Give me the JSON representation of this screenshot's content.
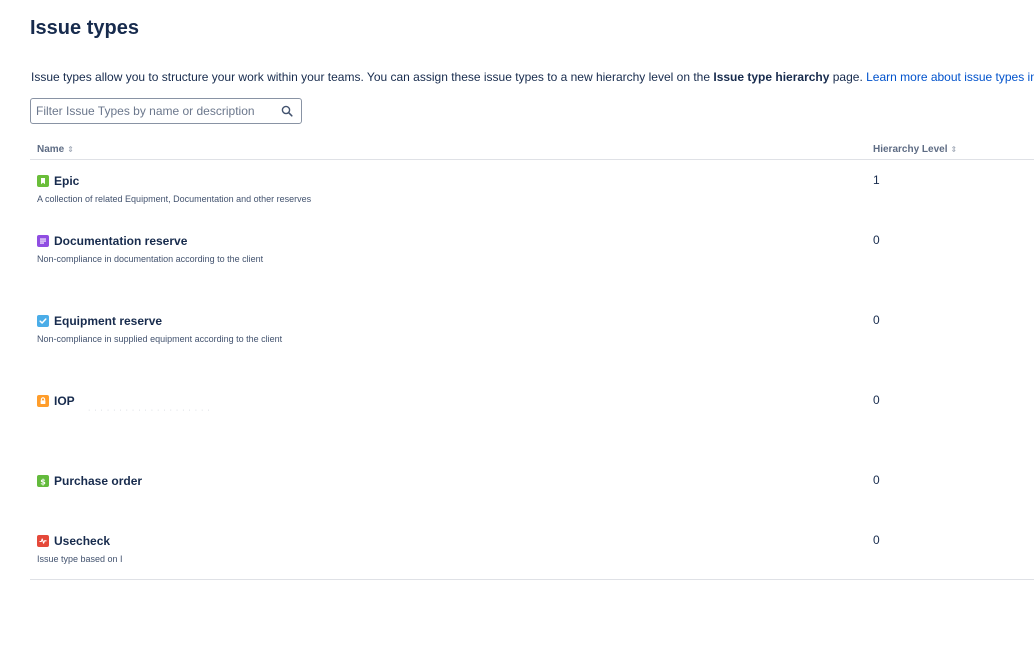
{
  "page": {
    "title": "Issue types",
    "intro": {
      "text_before": "Issue types allow you to structure your work within your teams. You can assign these issue types to a new hierarchy level on the ",
      "bold": "Issue type hierarchy",
      "text_after": " page. ",
      "link": "Learn more about issue types in Jira."
    }
  },
  "search": {
    "placeholder": "Filter Issue Types by name or description",
    "value": "",
    "icon": "search-icon"
  },
  "table": {
    "columns": {
      "name": "Name",
      "hierarchy": "Hierarchy Level"
    },
    "rows": [
      {
        "name": "Epic",
        "description": "A collection of related Equipment, Documentation and other reserves",
        "level": "1",
        "icon": "epic-icon",
        "color": "#6abe39"
      },
      {
        "name": "Documentation reserve",
        "description": "Non-compliance in documentation according to the client",
        "level": "0",
        "icon": "document-icon",
        "color": "#904ee2"
      },
      {
        "name": "Equipment reserve",
        "description": "Non-compliance in supplied equipment according to the client",
        "level": "0",
        "icon": "checkbox-icon",
        "color": "#4bade8"
      },
      {
        "name": "IOP",
        "description": "",
        "level": "0",
        "icon": "lock-icon",
        "color": "#ff9d2b"
      },
      {
        "name": "Purchase order",
        "description": "",
        "level": "0",
        "icon": "dollar-icon",
        "color": "#63ba3c"
      },
      {
        "name": "Usecheck",
        "description": "Issue type based on I",
        "level": "0",
        "icon": "pulse-icon",
        "color": "#e5493a"
      }
    ]
  },
  "colors": {
    "text": "#172b4d",
    "link": "#0052cc",
    "muted": "#5e6c84",
    "divider": "#dfe1e6"
  }
}
